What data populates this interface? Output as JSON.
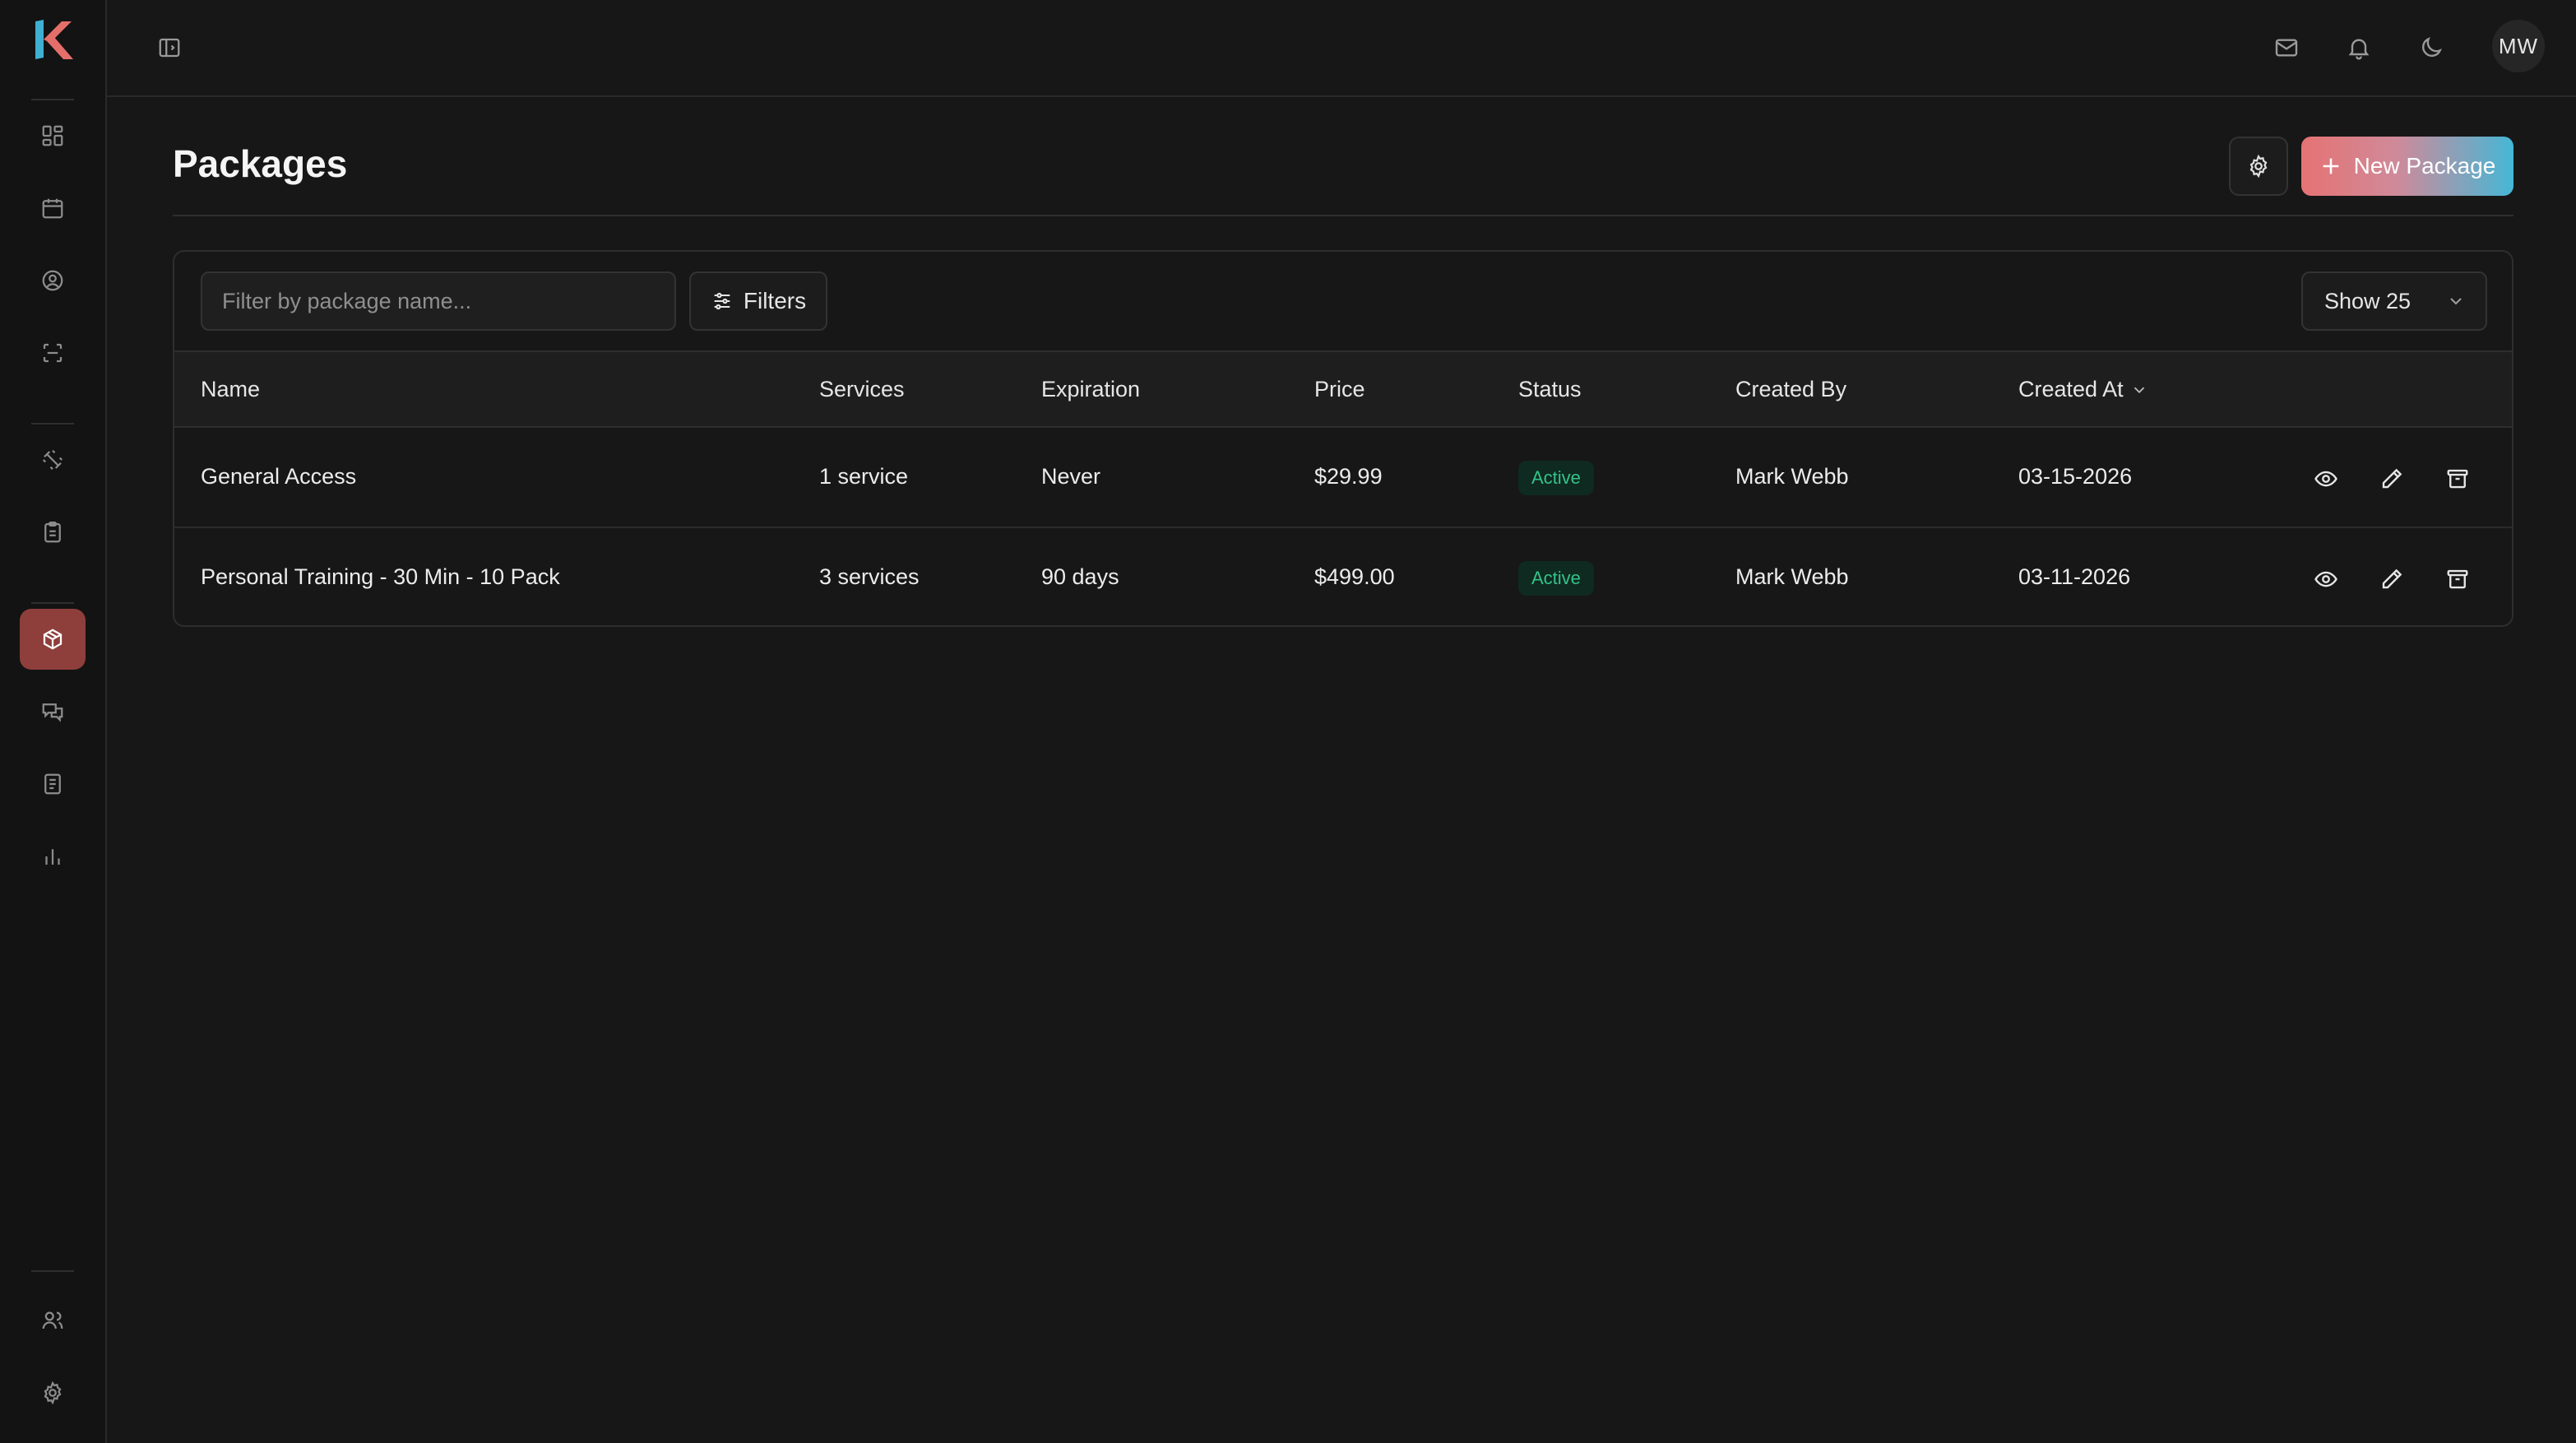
{
  "app": {
    "logo_icon": "k-logo-icon"
  },
  "sidebar": {
    "items": [
      {
        "id": "dashboard",
        "icon": "dashboard-icon",
        "active": false
      },
      {
        "id": "calendar",
        "icon": "calendar-icon",
        "active": false
      },
      {
        "id": "members",
        "icon": "user-circle-icon",
        "active": false
      },
      {
        "id": "scan",
        "icon": "scan-icon",
        "active": false
      },
      {
        "id": "equipment",
        "icon": "dumbbell-icon",
        "active": false
      },
      {
        "id": "checklist",
        "icon": "clipboard-icon",
        "active": false
      },
      {
        "id": "packages",
        "icon": "package-icon",
        "active": true
      },
      {
        "id": "messages",
        "icon": "messages-icon",
        "active": false
      },
      {
        "id": "documents",
        "icon": "document-icon",
        "active": false
      },
      {
        "id": "reports",
        "icon": "bar-chart-icon",
        "active": false
      },
      {
        "id": "staff",
        "icon": "users-icon",
        "active": false
      },
      {
        "id": "settings",
        "icon": "gear-icon",
        "active": false
      }
    ],
    "active_color": "#8e3f3b"
  },
  "topbar": {
    "avatar_initials": "MW",
    "icons": [
      "sidebar-toggle-icon",
      "mail-icon",
      "bell-icon",
      "moon-icon"
    ]
  },
  "page": {
    "title": "Packages",
    "new_button_label": "New Package"
  },
  "toolbar": {
    "search_placeholder": "Filter by package name...",
    "filters_label": "Filters",
    "page_size_label": "Show 25"
  },
  "table": {
    "columns": [
      "Name",
      "Services",
      "Expiration",
      "Price",
      "Status",
      "Created By",
      "Created At"
    ],
    "sort_column": "Created At",
    "rows": [
      {
        "name": "General Access",
        "services": "1 service",
        "expiration": "Never",
        "price": "$29.99",
        "status": "Active",
        "created_by": "Mark Webb",
        "created_at": "03-15-2026"
      },
      {
        "name": "Personal Training - 30 Min - 10 Pack",
        "services": "3 services",
        "expiration": "90 days",
        "price": "$499.00",
        "status": "Active",
        "created_by": "Mark Webb",
        "created_at": "03-11-2026"
      }
    ]
  },
  "colors": {
    "background": "#171717",
    "status_active_text": "#34c28a",
    "status_active_bg": "#0f2a20",
    "button_gradient_start": "#e57373",
    "button_gradient_end": "#45b7d6"
  }
}
